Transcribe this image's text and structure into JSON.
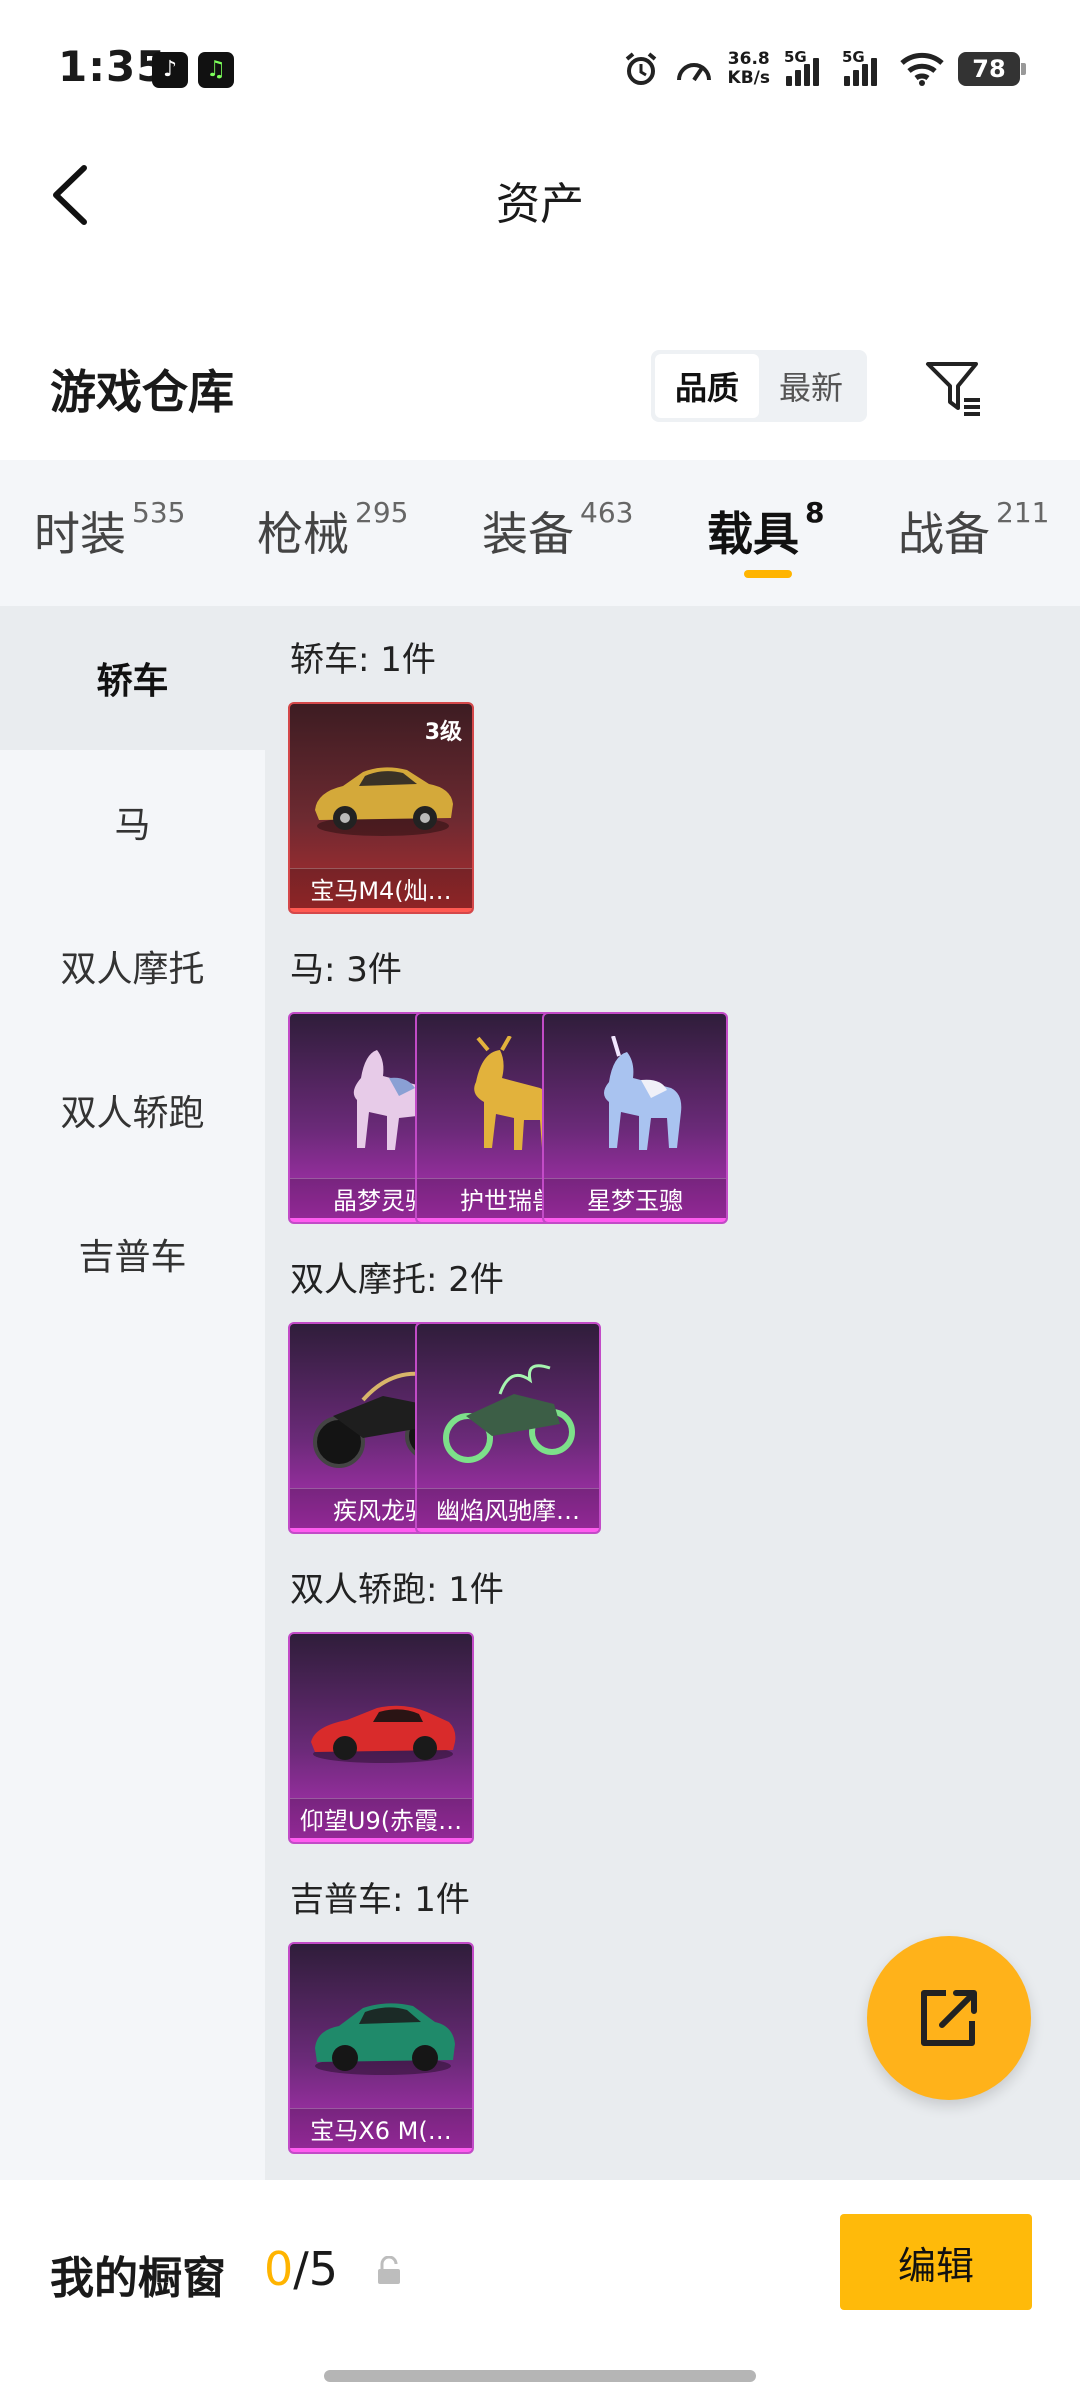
{
  "status_bar": {
    "time": "1:35",
    "net_speed_value": "36.8",
    "net_speed_unit": "KB/s",
    "sim1": "5G",
    "sim2": "5G",
    "battery": "78"
  },
  "header": {
    "title": "资产"
  },
  "warehouse": {
    "title": "游戏仓库",
    "sort_options": [
      "品质",
      "最新"
    ],
    "selected_sort": "品质"
  },
  "tabs": [
    {
      "label": "时装",
      "count": "535"
    },
    {
      "label": "枪械",
      "count": "295"
    },
    {
      "label": "装备",
      "count": "463"
    },
    {
      "label": "载具",
      "count": "8"
    },
    {
      "label": "战备",
      "count": "211"
    }
  ],
  "active_tab": "载具",
  "sidebar": [
    {
      "label": "轿车"
    },
    {
      "label": "马"
    },
    {
      "label": "双人摩托"
    },
    {
      "label": "双人轿跑"
    },
    {
      "label": "吉普车"
    }
  ],
  "groups": [
    {
      "label": "轿车: 1件",
      "items": [
        {
          "name": "宝马M4(灿…",
          "level": "3级",
          "rarity": "red",
          "icon": "gold-car-icon"
        }
      ]
    },
    {
      "label": "马: 3件",
      "items": [
        {
          "name": "晶梦灵驹",
          "rarity": "purple",
          "icon": "pink-horse-icon"
        },
        {
          "name": "护世瑞兽",
          "rarity": "purple",
          "icon": "gold-beast-icon"
        },
        {
          "name": "星梦玉骢",
          "rarity": "purple",
          "icon": "unicorn-icon"
        }
      ]
    },
    {
      "label": "双人摩托: 2件",
      "items": [
        {
          "name": "疾风龙骑",
          "rarity": "purple",
          "icon": "black-motorcycle-icon"
        },
        {
          "name": "幽焰风驰摩…",
          "rarity": "purple",
          "icon": "green-flame-motorcycle-icon"
        }
      ]
    },
    {
      "label": "双人轿跑: 1件",
      "items": [
        {
          "name": "仰望U9(赤霞…",
          "rarity": "purple",
          "icon": "red-supercar-icon"
        }
      ]
    },
    {
      "label": "吉普车: 1件",
      "items": [
        {
          "name": "宝马X6 M(…",
          "rarity": "purple",
          "icon": "green-suv-icon"
        }
      ]
    }
  ],
  "bottom": {
    "showcase_label": "我的橱窗",
    "showcase_current": "0",
    "showcase_total": "/5",
    "edit_label": "编辑"
  },
  "colors": {
    "accent": "#ffb400",
    "rarity_red": "#d4484a",
    "rarity_purple": "#c24bc7"
  }
}
